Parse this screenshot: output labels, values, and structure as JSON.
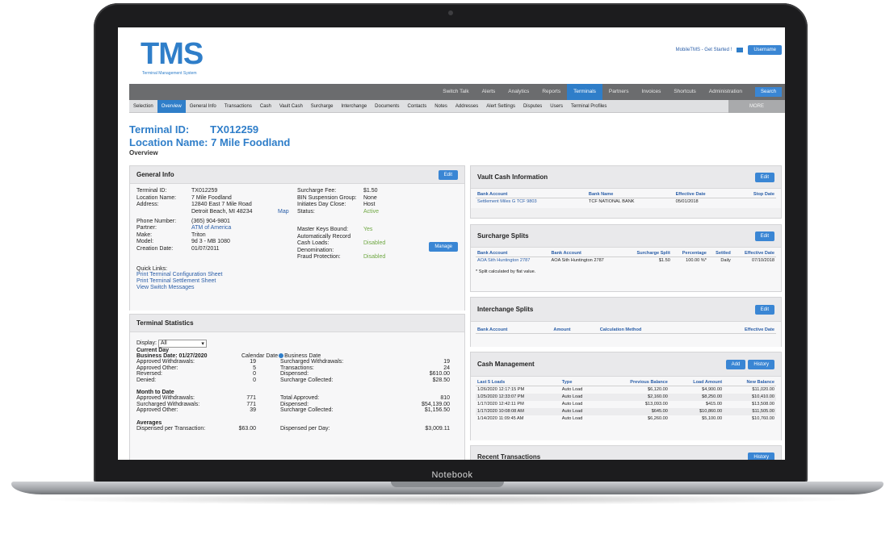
{
  "device": {
    "bezel_label": "Notebook"
  },
  "header": {
    "logo": "TMS",
    "logo_sub": "Terminal Management System",
    "top_link": "MobileTMS - Get Started !",
    "user_button": "Username"
  },
  "main_nav": [
    {
      "label": "Switch Talk",
      "active": false
    },
    {
      "label": "Alerts",
      "active": false
    },
    {
      "label": "Analytics",
      "active": false
    },
    {
      "label": "Reports",
      "active": false
    },
    {
      "label": "Terminals",
      "active": true
    },
    {
      "label": "Partners",
      "active": false
    },
    {
      "label": "Invoices",
      "active": false
    },
    {
      "label": "Shortcuts",
      "active": false
    },
    {
      "label": "Administration",
      "active": false
    }
  ],
  "search_button": "Search",
  "sub_nav": [
    {
      "label": "Selection",
      "active": false
    },
    {
      "label": "Overview",
      "active": true
    },
    {
      "label": "General Info",
      "active": false
    },
    {
      "label": "Transactions",
      "active": false
    },
    {
      "label": "Cash",
      "active": false
    },
    {
      "label": "Vault Cash",
      "active": false
    },
    {
      "label": "Surcharge",
      "active": false
    },
    {
      "label": "Interchange",
      "active": false
    },
    {
      "label": "Documents",
      "active": false
    },
    {
      "label": "Contacts",
      "active": false
    },
    {
      "label": "Notes",
      "active": false
    },
    {
      "label": "Addresses",
      "active": false
    },
    {
      "label": "Alert Settings",
      "active": false
    },
    {
      "label": "Disputes",
      "active": false
    },
    {
      "label": "Users",
      "active": false
    },
    {
      "label": "Terminal Profiles",
      "active": false
    }
  ],
  "sub_nav_more": "MORE",
  "page": {
    "terminal_id_label": "Terminal ID:",
    "terminal_id_value": "TX012259",
    "location_label": "Location Name:",
    "location_value": "7 Mile Foodland",
    "section": "Overview"
  },
  "general_info": {
    "title": "General Info",
    "edit": "Edit",
    "left": [
      {
        "k": "Terminal ID:",
        "v": "TX012259"
      },
      {
        "k": "Location Name:",
        "v": "7 Mile Foodland"
      },
      {
        "k": "Address:",
        "v": "12840 East 7 Mile Road"
      },
      {
        "k": "",
        "v": "Detroit Beach, MI 48234"
      }
    ],
    "map_link": "Map",
    "left2": [
      {
        "k": "Phone Number:",
        "v": "(365) 904-9801"
      },
      {
        "k": "Partner:",
        "v": "ATM of America"
      },
      {
        "k": "Make:",
        "v": "Triton"
      },
      {
        "k": "Model:",
        "v": "9d 3 - MB 1080"
      },
      {
        "k": "Creation Date:",
        "v": "01/07/2011"
      }
    ],
    "right": [
      {
        "k": "Surcharge Fee:",
        "v": "$1.50"
      },
      {
        "k": "BIN Suspension Group:",
        "v": "None"
      },
      {
        "k": "Initiates Day Close:",
        "v": "Host"
      },
      {
        "k": "Status:",
        "v": "Active"
      }
    ],
    "right2": [
      {
        "k": "Master Keys Bound:",
        "v": "Yes"
      },
      {
        "k": "Automatically Record",
        "v": ""
      },
      {
        "k": "Cash Loads:",
        "v": "Disabled"
      },
      {
        "k": "Denomination:",
        "v": ""
      },
      {
        "k": "Fraud Protection:",
        "v": "Disabled"
      }
    ],
    "manage_button": "Manage",
    "quick_links_label": "Quick Links:",
    "quick_links": [
      "Print Terminal Configuration Sheet",
      "Print Terminal Settlement Sheet",
      "View Switch Messages"
    ]
  },
  "terminal_stats": {
    "title": "Terminal Statistics",
    "display_label": "Display:",
    "display_value": "All",
    "current_day": "Current Day",
    "business_date": "Business Date: 01/27/2020",
    "calendar_date": "Calendar Date",
    "business_date_opt": "Business Date",
    "day_rows": [
      {
        "k": "Approved Withdrawals:",
        "v": "19",
        "k2": "Surcharged Withdrawals:",
        "v2": "19"
      },
      {
        "k": "Approved Other:",
        "v": "5",
        "k2": "Transactions:",
        "v2": "24"
      },
      {
        "k": "Reversed:",
        "v": "0",
        "k2": "Dispensed:",
        "v2": "$610.00"
      },
      {
        "k": "Denied:",
        "v": "0",
        "k2": "Surcharge Collected:",
        "v2": "$28.50"
      }
    ],
    "month_label": "Month to Date",
    "month_rows": [
      {
        "k": "Approved Withdrawals:",
        "v": "771",
        "k2": "Total Approved:",
        "v2": "810"
      },
      {
        "k": "Surcharged Withdrawals:",
        "v": "771",
        "k2": "Dispensed:",
        "v2": "$54,139.00"
      },
      {
        "k": "Approved Other:",
        "v": "39",
        "k2": "Surcharge Collected:",
        "v2": "$1,156.50"
      }
    ],
    "averages_label": "Averages",
    "avg_rows": [
      {
        "k": "Dispensed per Transaction:",
        "v": "$63.00",
        "k2": "Dispensed per Day:",
        "v2": "$3,009.11"
      }
    ]
  },
  "vault_cash": {
    "title": "Vault Cash Information",
    "edit": "Edit",
    "headers": [
      "Bank Account",
      "Bank Name",
      "Effective Date",
      "Stop Date"
    ],
    "rows": [
      [
        "Settlement Miles G TCF 9803",
        "TCF NATIONAL BANK",
        "05/01/2018",
        ""
      ]
    ]
  },
  "surcharge_splits": {
    "title": "Surcharge Splits",
    "edit": "Edit",
    "headers": [
      "Bank Account",
      "Bank Account",
      "Surcharge Split",
      "Percentage",
      "Settled",
      "Effective Date"
    ],
    "rows": [
      [
        "AOA Sith Huntington 2787",
        "AOA Sith Huntington 2787",
        "$1.50",
        "100.00 %*",
        "Daily",
        "07/10/2018"
      ]
    ],
    "note": "* Split calculated by flat value."
  },
  "interchange_splits": {
    "title": "Interchange Splits",
    "edit": "Edit",
    "headers": [
      "Bank Account",
      "Amount",
      "Calculation Method",
      "Effective Date"
    ]
  },
  "cash_management": {
    "title": "Cash Management",
    "add": "Add",
    "history": "History",
    "headers": [
      "Last 5 Loads",
      "Type",
      "Previous Balance",
      "Load Amount",
      "New Balance"
    ],
    "rows": [
      [
        "1/26/2020 12:17:15 PM",
        "Auto Load",
        "$6,120.00",
        "$4,900.00",
        "$11,020.00"
      ],
      [
        "1/25/2020 12:33:07 PM",
        "Auto Load",
        "$2,160.00",
        "$8,250.00",
        "$10,410.00"
      ],
      [
        "1/17/2020 12:42:11 PM",
        "Auto Load",
        "$13,093.00",
        "$415.00",
        "$13,508.00"
      ],
      [
        "1/17/2020 10:08:08 AM",
        "Auto Load",
        "$645.00",
        "$10,860.00",
        "$11,505.00"
      ],
      [
        "1/14/2020 11:09:45 AM",
        "Auto Load",
        "$6,260.00",
        "$5,100.00",
        "$10,760.00"
      ]
    ]
  },
  "recent_transactions": {
    "title": "Recent Transactions",
    "history": "History"
  }
}
